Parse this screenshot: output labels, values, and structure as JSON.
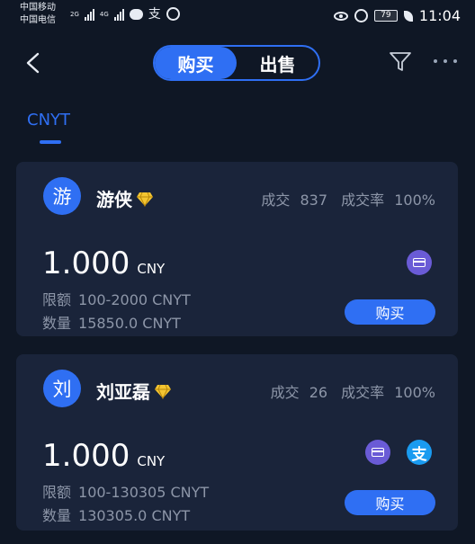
{
  "status_bar": {
    "carrier1": "中国移动",
    "carrier2": "中国电信",
    "net1": "2G",
    "net2": "4G",
    "alipay_glyph": "支",
    "battery": "79",
    "time": "11:04",
    "icons": [
      "signal-icon",
      "chat-bubble-icon",
      "alipay-icon",
      "circle-app-icon",
      "eye-icon",
      "alarm-icon",
      "battery-icon",
      "leaf-icon"
    ]
  },
  "header": {
    "tabs": [
      {
        "label": "购买",
        "active": true
      },
      {
        "label": "出售",
        "active": false
      }
    ],
    "icons": [
      "back-icon",
      "filter-icon",
      "more-icon"
    ]
  },
  "currency_tab": {
    "label": "CNYT"
  },
  "colors": {
    "accent": "#2f6ff3",
    "background": "#0f1725",
    "card": "#1a243a",
    "muted_text": "#8d96a8",
    "gem": "#f4c531"
  },
  "offers": [
    {
      "avatar": "游",
      "name": "游侠",
      "trades_label": "成交",
      "trades": "837",
      "rate_label": "成交率",
      "rate": "100%",
      "price": "1.000",
      "price_unit": "CNY",
      "limit_label": "限额",
      "limit": "100-2000 CNYT",
      "quantity_label": "数量",
      "quantity": "15850.0 CNYT",
      "payment_methods": [
        "bank-card-icon"
      ],
      "button": "购买"
    },
    {
      "avatar": "刘",
      "name": "刘亚磊",
      "trades_label": "成交",
      "trades": "26",
      "rate_label": "成交率",
      "rate": "100%",
      "price": "1.000",
      "price_unit": "CNY",
      "limit_label": "限额",
      "limit": "100-130305 CNYT",
      "quantity_label": "数量",
      "quantity": "130305.0 CNYT",
      "payment_methods": [
        "bank-card-icon",
        "alipay-icon"
      ],
      "alipay_glyph": "支",
      "button": "购买"
    }
  ]
}
